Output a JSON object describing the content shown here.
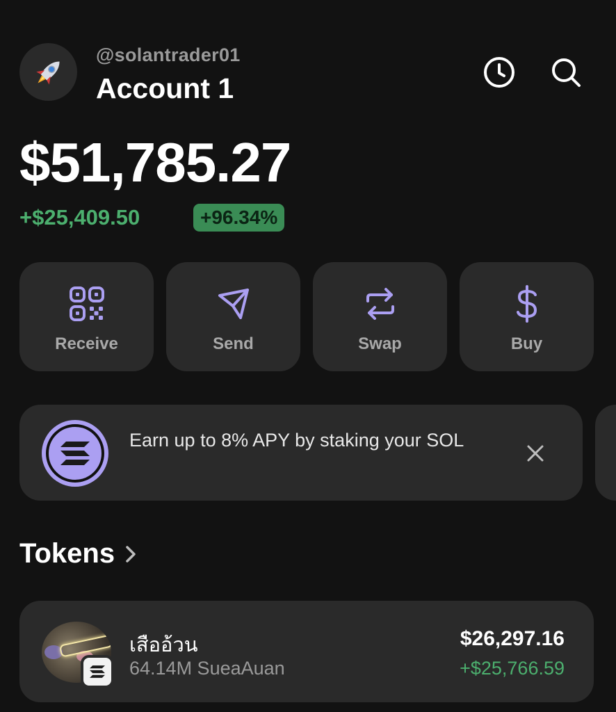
{
  "header": {
    "avatar_icon": "rocket-icon",
    "handle": "@solantrader01",
    "account_name": "Account 1",
    "history_icon": "clock-icon",
    "search_icon": "search-icon"
  },
  "balance": {
    "total": "$51,785.27",
    "change_amount": "+$25,409.50",
    "change_percent": "+96.34%"
  },
  "actions": [
    {
      "label": "Receive",
      "icon": "qr-code-icon"
    },
    {
      "label": "Send",
      "icon": "send-icon"
    },
    {
      "label": "Swap",
      "icon": "swap-icon"
    },
    {
      "label": "Buy",
      "icon": "dollar-icon"
    }
  ],
  "promo": {
    "text": "Earn up to 8% APY by staking your SOL",
    "icon": "solana-logo-icon"
  },
  "tokens": {
    "title": "Tokens",
    "items": [
      {
        "name": "เสืออ้วน",
        "amount": "64.14M SueaAuan",
        "value": "$26,297.16",
        "change": "+$25,766.59"
      }
    ]
  },
  "colors": {
    "background": "#121212",
    "card": "#2a2a2a",
    "accent": "#ab9ff2",
    "positive": "#4caf6e"
  }
}
